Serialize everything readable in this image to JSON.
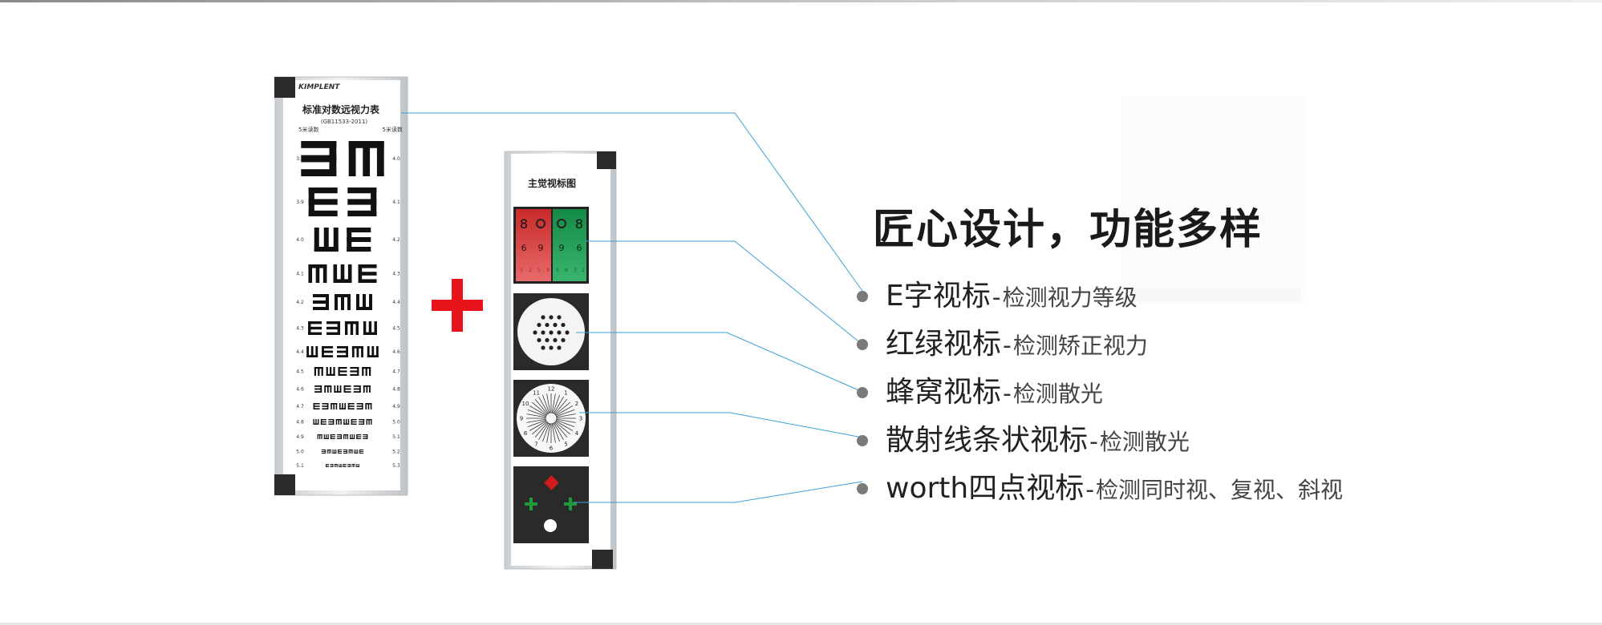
{
  "left_chart": {
    "brand": "KIMPLENT",
    "title": "标准对数远视力表",
    "standard": "(GB11533-2011)",
    "left_head": "5米读数",
    "right_head": "5米读数",
    "left_values": [
      "3.8",
      "3.9",
      "4.0",
      "4.1",
      "4.2",
      "4.3",
      "4.4",
      "4.5",
      "4.6",
      "4.7",
      "4.8",
      "4.9",
      "5.0",
      "5.1"
    ],
    "right_values": [
      "4.0",
      "4.1",
      "4.2",
      "4.3",
      "4.4",
      "4.5",
      "4.6",
      "4.7",
      "4.8",
      "4.9",
      "5.0",
      "5.1",
      "5.2",
      "5.3"
    ]
  },
  "right_chart": {
    "title": "主觉视标图",
    "red_green_digits": [
      "8",
      "9",
      "6",
      "9",
      "6",
      "8"
    ],
    "clock_numbers": [
      "12",
      "1",
      "2",
      "3",
      "4",
      "5",
      "6",
      "7",
      "8",
      "9",
      "10",
      "11"
    ]
  },
  "colors": {
    "plus": "#e8141c",
    "red_panel": "#cf3535",
    "green_panel": "#1e9a52",
    "leader_line": "#3aa0d6",
    "marker_dot": "#7a7a7a",
    "worth_green": "#1f9a3b",
    "worth_red": "#d01c1c"
  },
  "headline": "匠心设计，功能多样",
  "features": [
    {
      "name": "E字视标",
      "desc": "检测视力等级"
    },
    {
      "name": "红绿视标",
      "desc": "检测矫正视力"
    },
    {
      "name": "蜂窝视标",
      "desc": "检测散光"
    },
    {
      "name": "散射线条状视标",
      "desc": "检测散光"
    },
    {
      "name": "worth四点视标",
      "desc": "检测同时视、复视、斜视"
    }
  ]
}
